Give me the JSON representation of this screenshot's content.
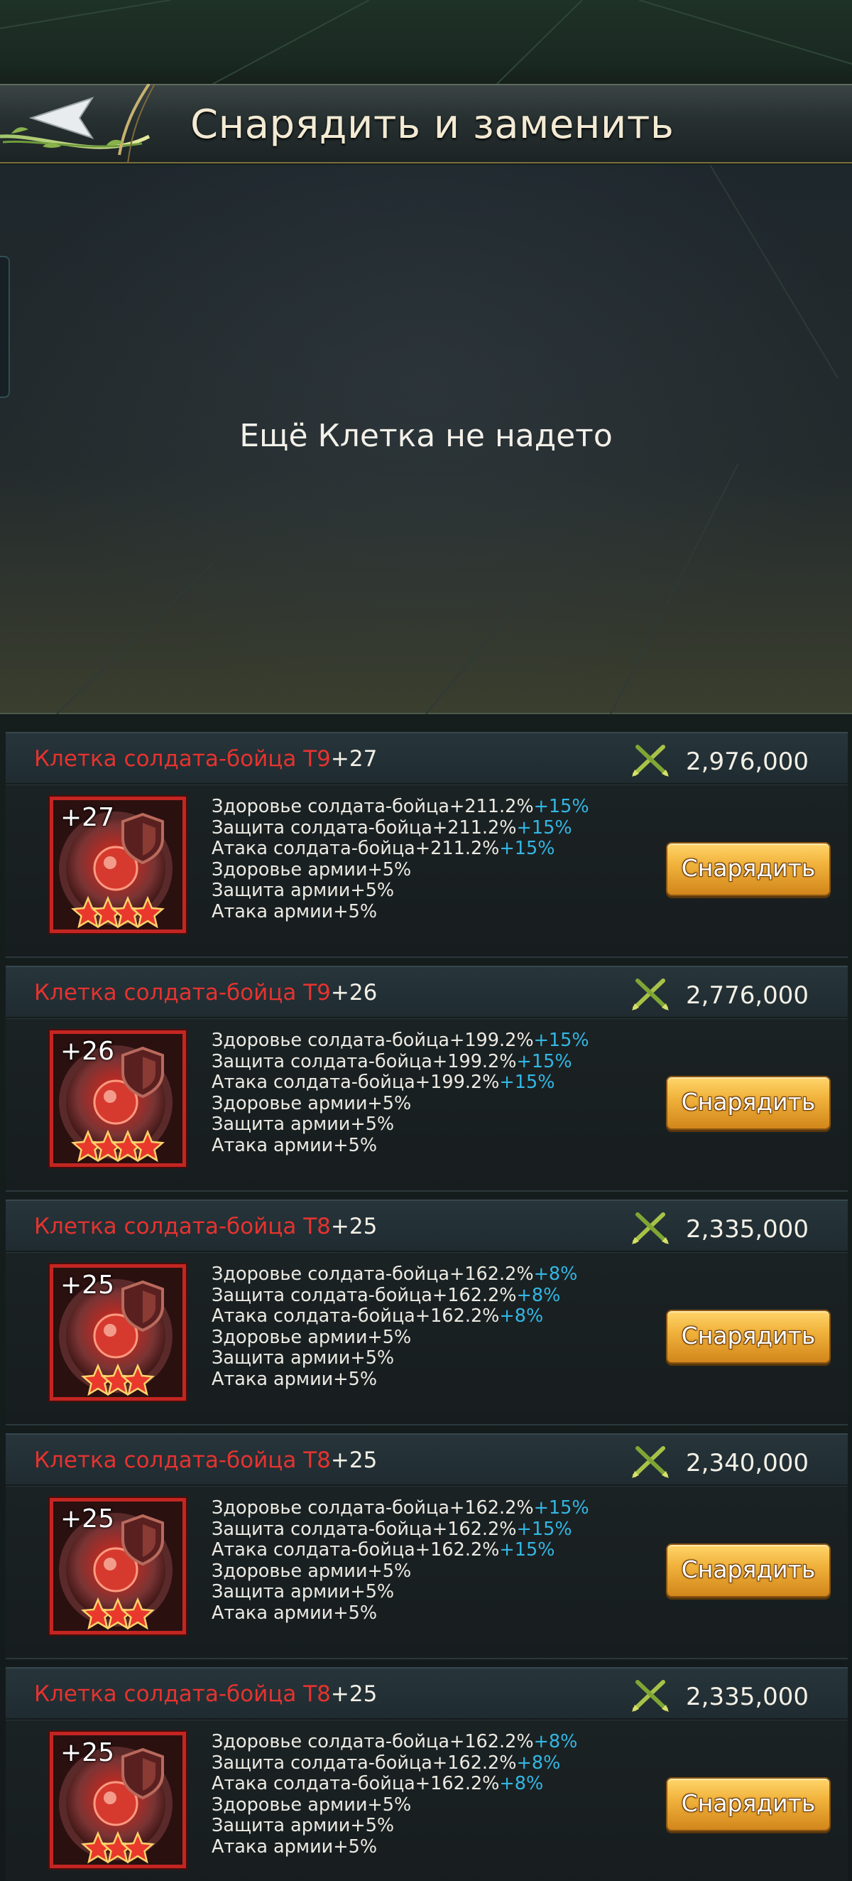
{
  "header": {
    "title": "Снарядить и заменить",
    "back_icon": "back-arrow-icon"
  },
  "slot": {
    "empty_message": "Ещё Клетка не надето"
  },
  "colors": {
    "item_name": "#e5332f",
    "bonus": "#33b7e4",
    "button": "#f1b33c",
    "icon_border": "#c32622"
  },
  "items": [
    {
      "name": "Клетка солдата-бойца T9",
      "level": "+27",
      "stars": 4,
      "power_icon": "crossed-swords-icon",
      "power": "2,976,000",
      "stats": [
        {
          "text": "Здоровье солдата-бойца+211.2%",
          "bonus": "+15%"
        },
        {
          "text": "Защита солдата-бойца+211.2%",
          "bonus": "+15%"
        },
        {
          "text": "Атака солдата-бойца+211.2%",
          "bonus": "+15%"
        },
        {
          "text": "Здоровье армии+5%",
          "bonus": ""
        },
        {
          "text": "Защита армии+5%",
          "bonus": ""
        },
        {
          "text": "Атака армии+5%",
          "bonus": ""
        }
      ],
      "button": "Снарядить"
    },
    {
      "name": "Клетка солдата-бойца T9",
      "level": "+26",
      "stars": 4,
      "power_icon": "crossed-swords-icon",
      "power": "2,776,000",
      "stats": [
        {
          "text": "Здоровье солдата-бойца+199.2%",
          "bonus": "+15%"
        },
        {
          "text": "Защита солдата-бойца+199.2%",
          "bonus": "+15%"
        },
        {
          "text": "Атака солдата-бойца+199.2%",
          "bonus": "+15%"
        },
        {
          "text": "Здоровье армии+5%",
          "bonus": ""
        },
        {
          "text": "Защита армии+5%",
          "bonus": ""
        },
        {
          "text": "Атака армии+5%",
          "bonus": ""
        }
      ],
      "button": "Снарядить"
    },
    {
      "name": "Клетка солдата-бойца T8",
      "level": "+25",
      "stars": 3,
      "power_icon": "crossed-swords-icon",
      "power": "2,335,000",
      "stats": [
        {
          "text": "Здоровье солдата-бойца+162.2%",
          "bonus": "+8%"
        },
        {
          "text": "Защита солдата-бойца+162.2%",
          "bonus": "+8%"
        },
        {
          "text": "Атака солдата-бойца+162.2%",
          "bonus": "+8%"
        },
        {
          "text": "Здоровье армии+5%",
          "bonus": ""
        },
        {
          "text": "Защита армии+5%",
          "bonus": ""
        },
        {
          "text": "Атака армии+5%",
          "bonus": ""
        }
      ],
      "button": "Снарядить"
    },
    {
      "name": "Клетка солдата-бойца T8",
      "level": "+25",
      "stars": 3,
      "power_icon": "crossed-swords-icon",
      "power": "2,340,000",
      "stats": [
        {
          "text": "Здоровье солдата-бойца+162.2%",
          "bonus": "+15%"
        },
        {
          "text": "Защита солдата-бойца+162.2%",
          "bonus": "+15%"
        },
        {
          "text": "Атака солдата-бойца+162.2%",
          "bonus": "+15%"
        },
        {
          "text": "Здоровье армии+5%",
          "bonus": ""
        },
        {
          "text": "Защита армии+5%",
          "bonus": ""
        },
        {
          "text": "Атака армии+5%",
          "bonus": ""
        }
      ],
      "button": "Снарядить"
    },
    {
      "name": "Клетка солдата-бойца T8",
      "level": "+25",
      "stars": 3,
      "power_icon": "crossed-swords-icon",
      "power": "2,335,000",
      "stats": [
        {
          "text": "Здоровье солдата-бойца+162.2%",
          "bonus": "+8%"
        },
        {
          "text": "Защита солдата-бойца+162.2%",
          "bonus": "+8%"
        },
        {
          "text": "Атака солдата-бойца+162.2%",
          "bonus": "+8%"
        },
        {
          "text": "Здоровье армии+5%",
          "bonus": ""
        },
        {
          "text": "Защита армии+5%",
          "bonus": ""
        },
        {
          "text": "Атака армии+5%",
          "bonus": ""
        }
      ],
      "button": "Снарядить"
    }
  ]
}
